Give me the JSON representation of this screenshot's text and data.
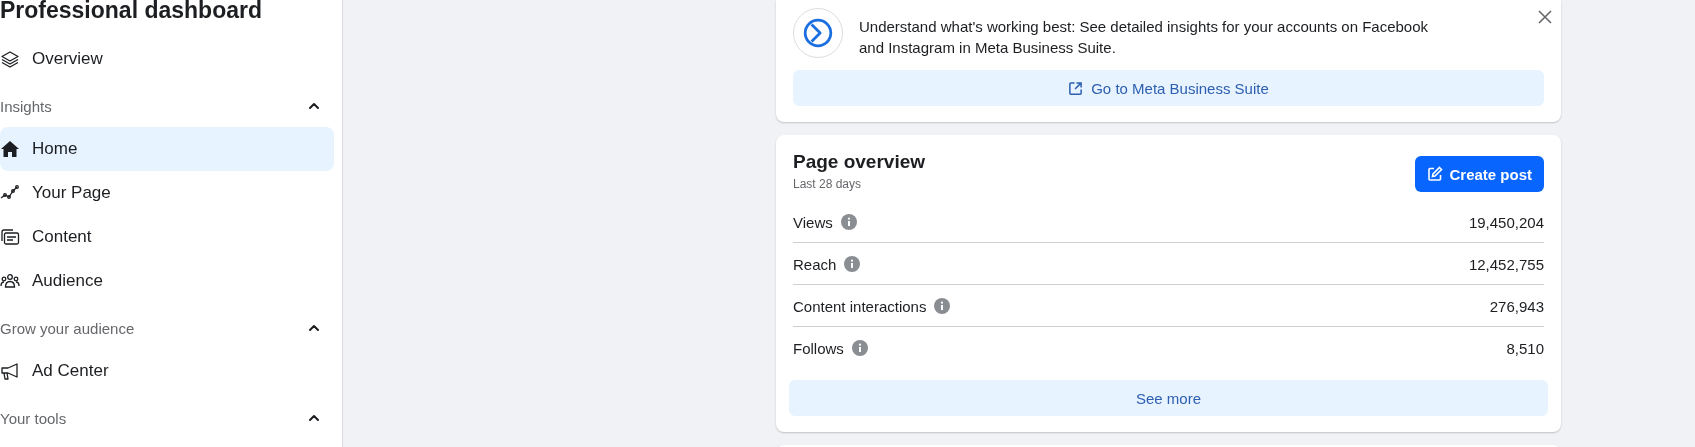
{
  "sidebar": {
    "title": "Professional dashboard",
    "items": [
      {
        "kind": "item",
        "label": "Overview",
        "selected": false
      },
      {
        "kind": "section",
        "label": "Insights",
        "expanded": true
      },
      {
        "kind": "item",
        "label": "Home",
        "selected": true
      },
      {
        "kind": "item",
        "label": "Your Page",
        "selected": false
      },
      {
        "kind": "item",
        "label": "Content",
        "selected": false
      },
      {
        "kind": "item",
        "label": "Audience",
        "selected": false
      },
      {
        "kind": "section",
        "label": "Grow your audience",
        "expanded": true
      },
      {
        "kind": "item",
        "label": "Ad Center",
        "selected": false
      },
      {
        "kind": "section",
        "label": "Your tools",
        "expanded": true
      }
    ]
  },
  "banner": {
    "text": "Understand what's working best: See detailed insights for your accounts on Facebook and Instagram in Meta Business Suite.",
    "button": "Go to Meta Business Suite"
  },
  "overview": {
    "title": "Page overview",
    "subtitle": "Last 28 days",
    "create_button": "Create post",
    "metrics": [
      {
        "label": "Views",
        "value": "19,450,204"
      },
      {
        "label": "Reach",
        "value": "12,452,755"
      },
      {
        "label": "Content interactions",
        "value": "276,943"
      },
      {
        "label": "Follows",
        "value": "8,510"
      }
    ],
    "more_button": "See more"
  }
}
